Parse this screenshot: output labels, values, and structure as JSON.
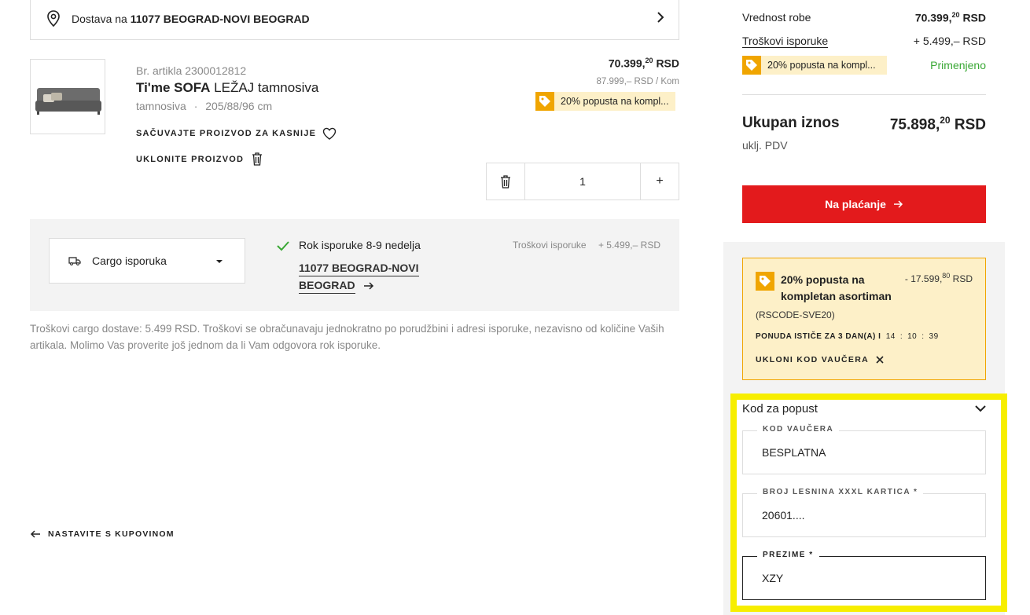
{
  "delivery": {
    "prefix": "Dostava na",
    "location": "11077 BEOGRAD-NOVI BEOGRAD"
  },
  "product": {
    "sku_label": "Br. artikla 2300012812",
    "name_bold": "Ti'me SOFA",
    "name_rest": "LEŽAJ tamnosiva",
    "color": "tamnosiva",
    "separator": "·",
    "dimensions": "205/88/96 cm",
    "price_main": "70.399,",
    "price_sup": "20",
    "price_currency": "RSD",
    "unit_price": "87.999,– RSD / Kom",
    "promo": "20% popusta na kompl...",
    "save_label": "SAČUVAJTE PROIZVOD ZA KASNIJE",
    "remove_label": "UKLONITE PROIZVOD",
    "quantity": "1"
  },
  "shipping": {
    "method": "Cargo isporuka",
    "eta": "Rok isporuke 8-9 nedelja",
    "address_line1": "11077 BEOGRAD-NOVI",
    "address_line2": "BEOGRAD",
    "cost_label": "Troškovi isporuke",
    "cost_value": "+ 5.499,– RSD",
    "note": "Troškovi cargo dostave: 5.499 RSD. Troškovi se obračunavaju jednokratno po porudžbini i adresi isporuke, nezavisno od količine Vaših artikala. Molimo Vas proverite još jednom da li Vam odgovora rok isporuke."
  },
  "continue_label": "NASTAVITE S KUPOVINOM",
  "summary": {
    "goods_label": "Vrednost robe",
    "goods_main": "70.399,",
    "goods_sup": "20",
    "goods_currency": "RSD",
    "shipping_label": "Troškovi isporuke",
    "shipping_value": "+ 5.499,– RSD",
    "promo": "20% popusta na kompl...",
    "promo_status": "Primenjeno",
    "total_label": "Ukupan iznos",
    "total_main": "75.898,",
    "total_sup": "20",
    "total_currency": "RSD",
    "vat_label": "uklj. PDV",
    "checkout_label": "Na plaćanje"
  },
  "voucher": {
    "title": "20% popusta na kompletan asortiman",
    "title_line1": "20% popusta na",
    "title_line2": "kompletan asortiman",
    "discount_main": "- 17.599,",
    "discount_sup": "80",
    "discount_currency": "RSD",
    "code": "(RSCODE-SVE20)",
    "expiry_prefix": "PONUDA ISTIČE ZA 3 DAN(A) I",
    "hh": "14",
    "mm": "10",
    "ss": "39",
    "remove_label": "UKLONI KOD VAUČERA"
  },
  "discount_form": {
    "title": "Kod za popust",
    "voucher_label": "KOD VAUČERA",
    "voucher_value": "BESPLATNA",
    "card_label": "BROJ LESNINA XXXL KARTICA *",
    "card_value": "20601....",
    "surname_label": "PREZIME *",
    "surname_value": "XZY"
  },
  "colors": {
    "accent_red": "#e31a1c",
    "promo_orange": "#f0a500",
    "promo_bg": "#fdf0c8",
    "applied_green": "#3aa835",
    "highlight_yellow": "#f7ee00"
  }
}
